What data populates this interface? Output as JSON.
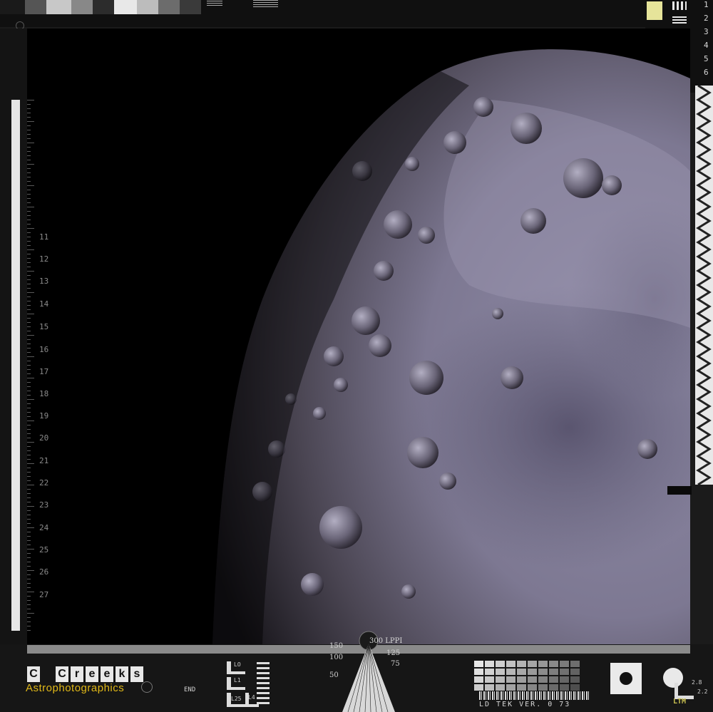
{
  "photo": {
    "subject": "moon-surface",
    "colors": {
      "background": "#000000",
      "lunar_surface": "#8c8aa8",
      "lunar_shadow": "#3a3640"
    }
  },
  "ruler": {
    "ticks": [
      "11",
      "12",
      "13",
      "14",
      "15",
      "16",
      "17",
      "18",
      "19",
      "20",
      "21",
      "22",
      "23",
      "24",
      "25",
      "26",
      "27"
    ]
  },
  "resolution_chart": {
    "rows": [
      "1",
      "2",
      "3",
      "4",
      "5",
      "6"
    ]
  },
  "lppi": {
    "label": "300 LPPI",
    "values": [
      "150",
      "100",
      "50",
      "125",
      "75"
    ]
  },
  "logo": {
    "letters": [
      "C",
      "C",
      "r",
      "e",
      "e",
      "k",
      "s"
    ],
    "subtitle": "Astrophotographics"
  },
  "footer": {
    "ld_tek": "LD TEK VER. 0 73",
    "end_label": "END",
    "ltm": "LTM",
    "corner_small": [
      "LO",
      "L1",
      "L25",
      "L4"
    ],
    "side_numbers": [
      "2.8",
      "2.2"
    ]
  },
  "colors": {
    "accent_yellow": "#e0b818",
    "frame": "#1b1b1b",
    "light": "#e8e8e8"
  }
}
